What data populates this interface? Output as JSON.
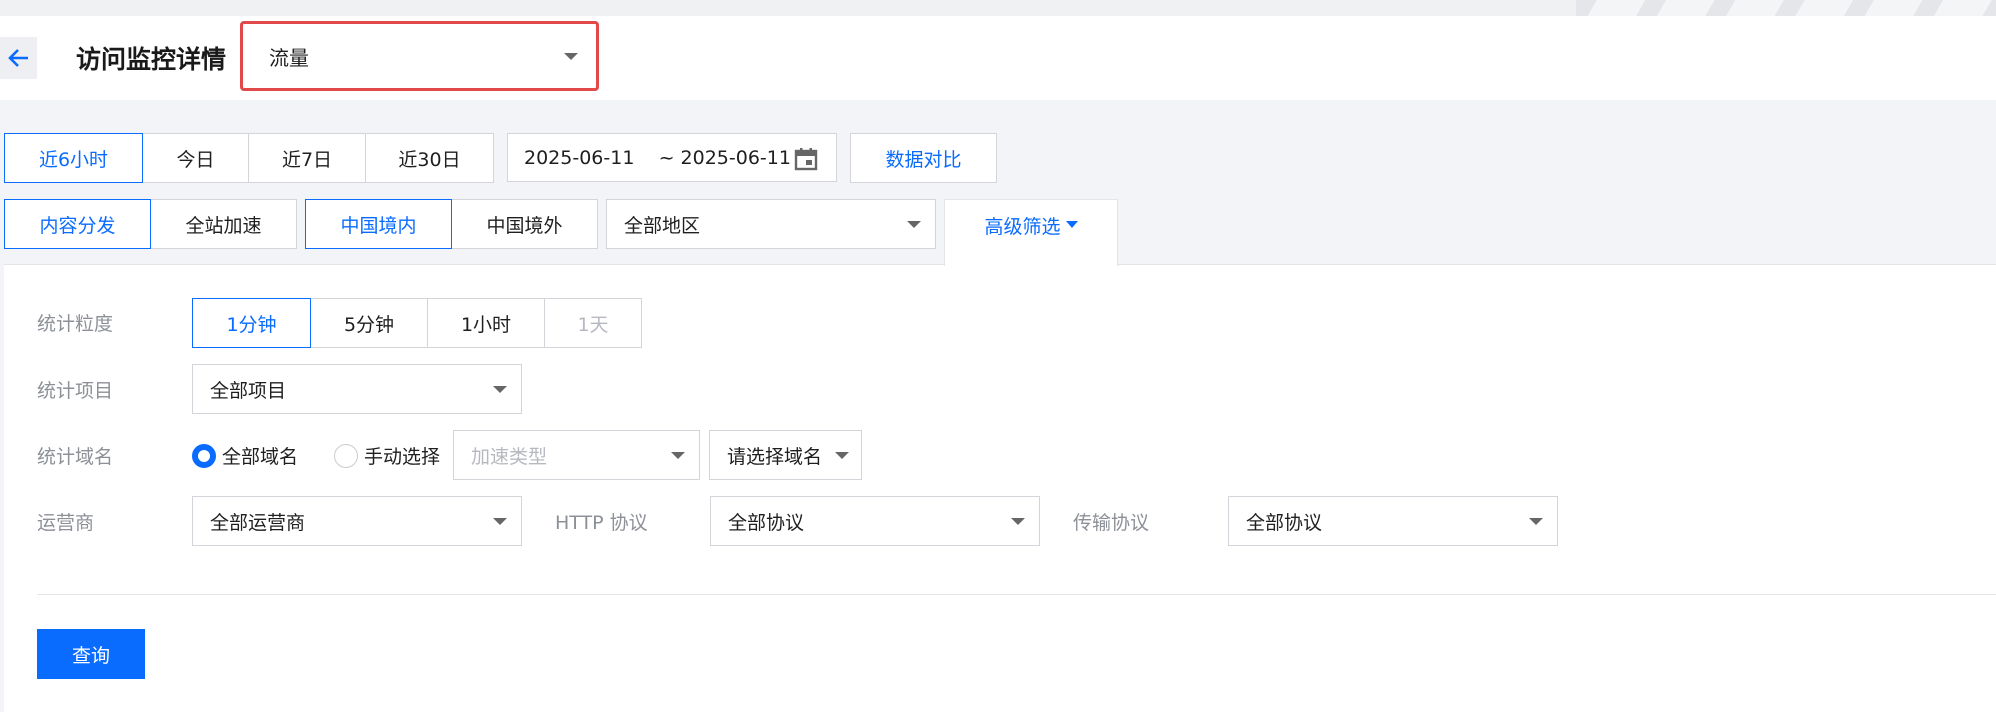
{
  "header": {
    "title": "访问监控详情",
    "metric_select": "流量"
  },
  "time_range": {
    "buttons": [
      "近6小时",
      "今日",
      "近7日",
      "近30日"
    ],
    "active": "近6小时",
    "date_range": "2025-06-11    ~ 2025-06-11",
    "compare_label": "数据对比"
  },
  "filters": {
    "service_buttons": [
      "内容分发",
      "全站加速"
    ],
    "service_active": "内容分发",
    "region_buttons": [
      "中国境内",
      "中国境外"
    ],
    "region_active": "中国境内",
    "area_select": "全部地区",
    "advanced_label": "高级筛选"
  },
  "advanced": {
    "granularity_label": "统计粒度",
    "granularity_options": [
      "1分钟",
      "5分钟",
      "1小时",
      "1天"
    ],
    "granularity_active": "1分钟",
    "granularity_disabled": "1天",
    "item_label": "统计项目",
    "item_select": "全部项目",
    "domain_label": "统计域名",
    "domain_radio_all": "全部域名",
    "domain_radio_manual": "手动选择",
    "domain_radio_selected": "全部域名",
    "accel_type_placeholder": "加速类型",
    "domain_select": "请选择域名",
    "isp_label": "运营商",
    "isp_select": "全部运营商",
    "http_label": "HTTP 协议",
    "http_select": "全部协议",
    "transport_label": "传输协议",
    "transport_select": "全部协议",
    "query_label": "查询"
  },
  "colors": {
    "accent": "#0a6cff",
    "highlight_border": "#e24a4a"
  },
  "icons": {
    "back": "arrow-left-icon",
    "calendar": "calendar-icon",
    "dropdown": "caret-down-icon"
  }
}
